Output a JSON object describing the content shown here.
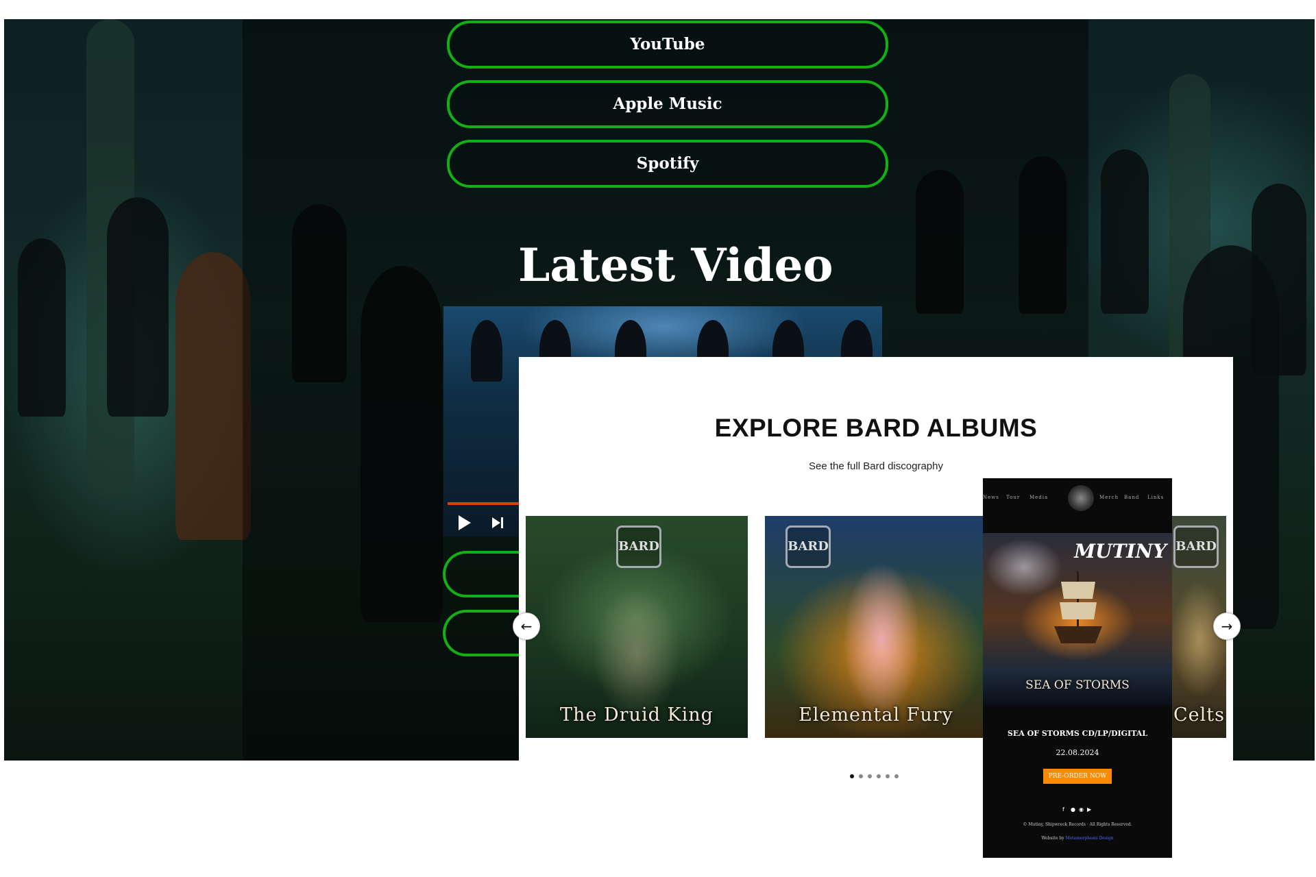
{
  "streaming": {
    "youtube": "YouTube",
    "apple_music": "Apple Music",
    "spotify": "Spotify"
  },
  "latest_video": {
    "heading": "Latest Video"
  },
  "albums": {
    "title": "EXPLORE BARD ALBUMS",
    "subtitle": "See the full Bard discography",
    "band_logo_text": "BARD",
    "covers": [
      {
        "title": "The Druid King"
      },
      {
        "title": "Elemental Fury"
      },
      {
        "title": "Celts"
      }
    ],
    "dots_total": 6,
    "dots_active": 1
  },
  "mobile_promo": {
    "nav": [
      "News",
      "Tour",
      "Media",
      "Merch",
      "Band",
      "Links"
    ],
    "band_name": "MUTINY",
    "album_art_title": "SEA OF STORMS",
    "product_line": "SEA OF STORMS CD/LP/DIGITAL",
    "release_date": "22.08.2024",
    "preorder_label": "PRE-ORDER NOW",
    "copyright": "© Mutiny, Shipwreck Records · All Rights Reserved.",
    "website_prefix": "Website by",
    "website_link": "Metamorphosis Design",
    "social_icons": [
      "facebook-icon",
      "twitter-icon",
      "instagram-icon",
      "youtube-icon"
    ]
  },
  "colors": {
    "accent_green": "#12b015",
    "preorder_orange": "#ff8a00",
    "video_progress": "#e23b12"
  }
}
